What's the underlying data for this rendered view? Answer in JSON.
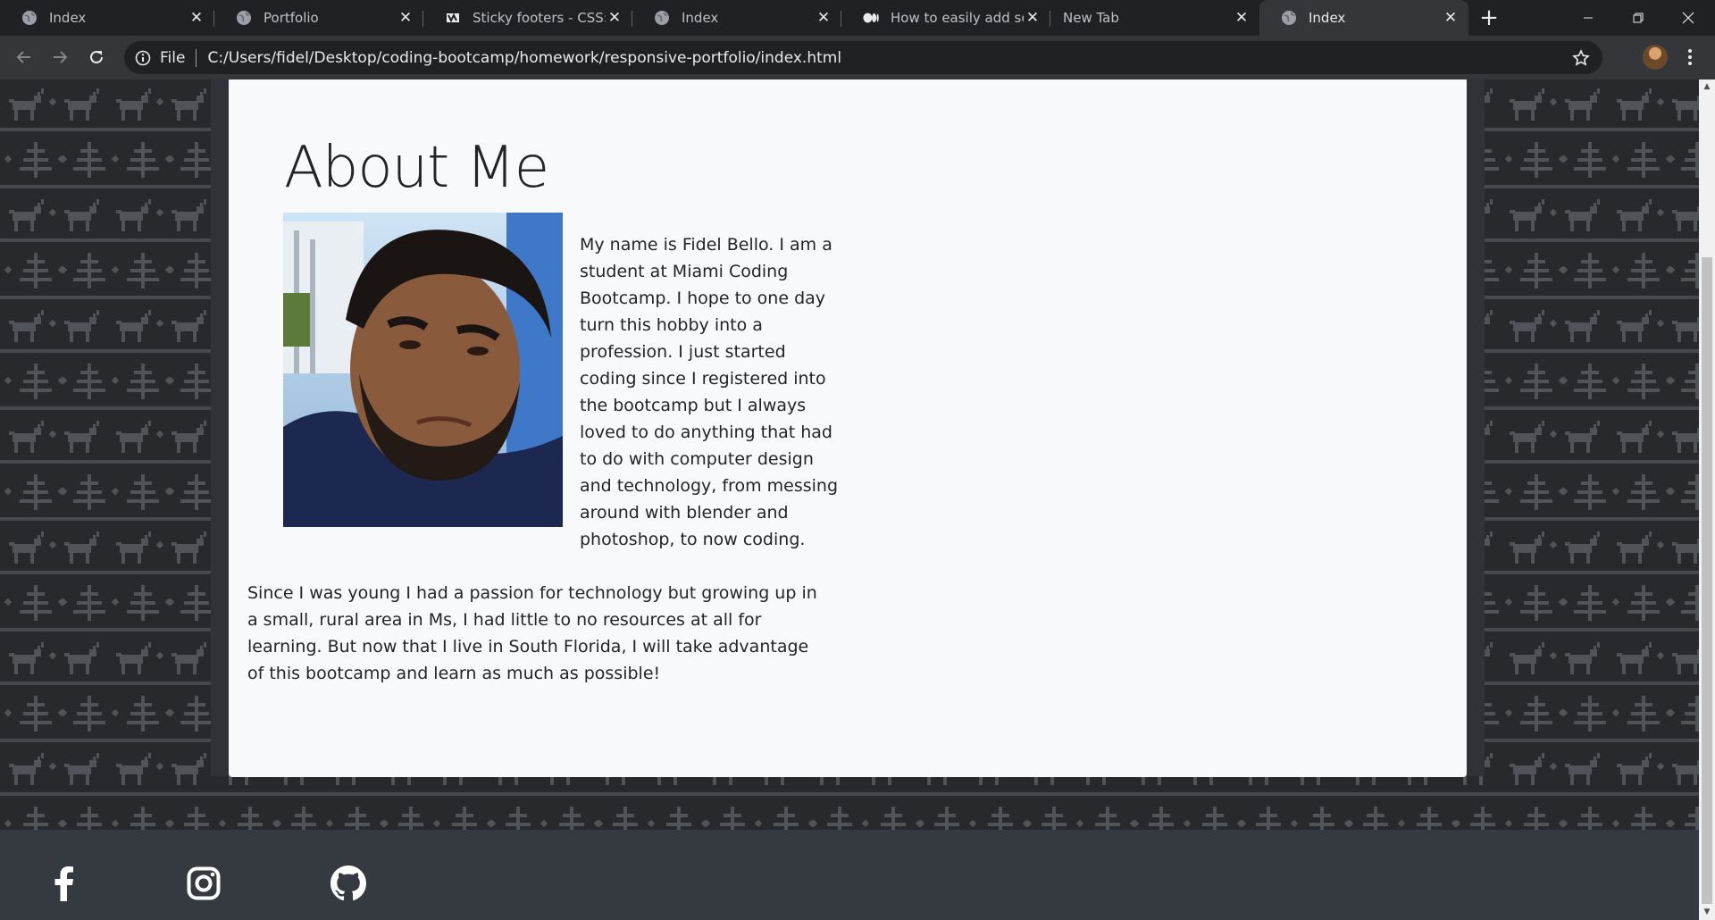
{
  "tabs": [
    {
      "title": "Index",
      "icon": "globe-icon",
      "active": false
    },
    {
      "title": "Portfolio",
      "icon": "globe-icon",
      "active": false
    },
    {
      "title": "Sticky footers - CSS: Ca",
      "icon": "mdn-icon",
      "active": false
    },
    {
      "title": "Index",
      "icon": "globe-icon",
      "active": false
    },
    {
      "title": "How to easily add scre",
      "icon": "medium-icon",
      "active": false
    },
    {
      "title": "New Tab",
      "icon": "",
      "active": false
    },
    {
      "title": "Index",
      "icon": "globe-icon",
      "active": true
    }
  ],
  "toolbar": {
    "scheme_label": "File",
    "url": "C:/Users/fidel/Desktop/coding-bootcamp/homework/responsive-portfolio/index.html"
  },
  "page": {
    "title": "About Me",
    "photo_alt": "Portrait photo",
    "para1": "My name is Fidel Bello. I am a student at Miami Coding Bootcamp. I hope to one day turn this hobby into a profession. I just started coding since I registered into the bootcamp but I always loved to do anything that had to do with computer design and technology, from messing around with blender and photoshop, to now coding.",
    "para2": "Since I was young I had a passion for technology but growing up in a small, rural area in Ms, I had little to no resources at all for learning. But now that I live in South Florida, I will take advantage of this bootcamp and learn as much as possible!"
  },
  "footer": {
    "icons": [
      "facebook-icon",
      "instagram-icon",
      "github-icon"
    ]
  },
  "colors": {
    "browser_dark": "#202124",
    "toolbar": "#35363a",
    "card": "#f8f9fa",
    "page_bg": "#27292d",
    "footer": "#343a40",
    "text": "#212529"
  }
}
